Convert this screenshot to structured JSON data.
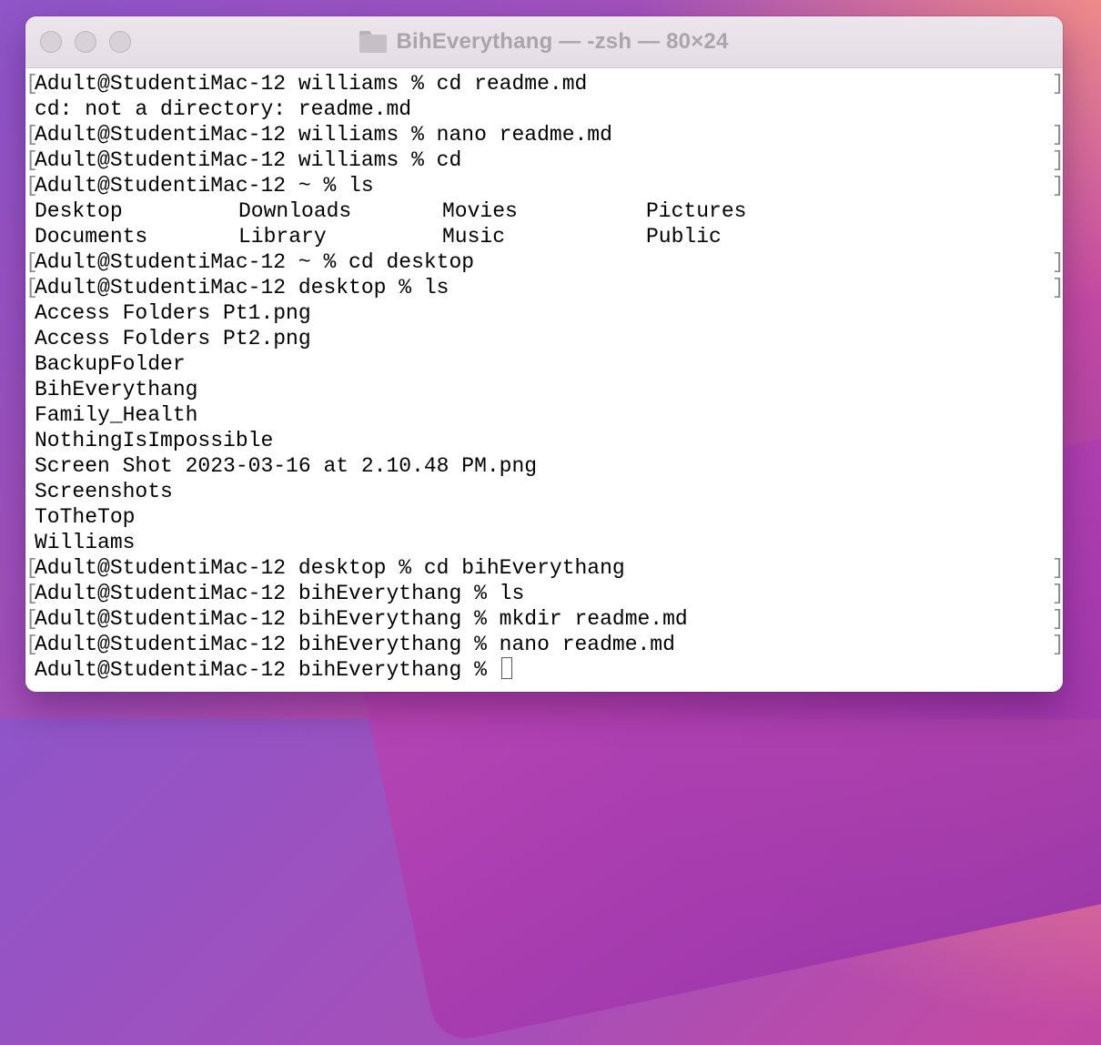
{
  "window": {
    "title": "BihEverythang — -zsh — 80×24"
  },
  "terminal": {
    "lines": [
      {
        "text": "Adult@StudentiMac-12 williams % cd readme.md",
        "marked": true
      },
      {
        "text": "cd: not a directory: readme.md",
        "marked": false
      },
      {
        "text": "Adult@StudentiMac-12 williams % nano readme.md",
        "marked": true
      },
      {
        "text": "Adult@StudentiMac-12 williams % cd",
        "marked": true
      },
      {
        "text": "Adult@StudentiMac-12 ~ % ls",
        "marked": true
      },
      {
        "cols": [
          "Desktop",
          "Downloads",
          "Movies",
          "Pictures"
        ]
      },
      {
        "cols": [
          "Documents",
          "Library",
          "Music",
          "Public"
        ]
      },
      {
        "text": "Adult@StudentiMac-12 ~ % cd desktop",
        "marked": true
      },
      {
        "text": "Adult@StudentiMac-12 desktop % ls",
        "marked": true
      },
      {
        "text": "Access Folders Pt1.png",
        "marked": false
      },
      {
        "text": "Access Folders Pt2.png",
        "marked": false
      },
      {
        "text": "BackupFolder",
        "marked": false
      },
      {
        "text": "BihEverythang",
        "marked": false
      },
      {
        "text": "Family_Health",
        "marked": false
      },
      {
        "text": "NothingIsImpossible",
        "marked": false
      },
      {
        "text": "Screen Shot 2023-03-16 at 2.10.48 PM.png",
        "marked": false
      },
      {
        "text": "Screenshots",
        "marked": false
      },
      {
        "text": "ToTheTop",
        "marked": false
      },
      {
        "text": "Williams",
        "marked": false
      },
      {
        "text": "Adult@StudentiMac-12 desktop % cd bihEverythang",
        "marked": true
      },
      {
        "text": "Adult@StudentiMac-12 bihEverythang % ls",
        "marked": true
      },
      {
        "text": "Adult@StudentiMac-12 bihEverythang % mkdir readme.md",
        "marked": true
      },
      {
        "text": "Adult@StudentiMac-12 bihEverythang % nano readme.md",
        "marked": true
      },
      {
        "text": "Adult@StudentiMac-12 bihEverythang % ",
        "marked": false,
        "cursor": true
      }
    ]
  }
}
